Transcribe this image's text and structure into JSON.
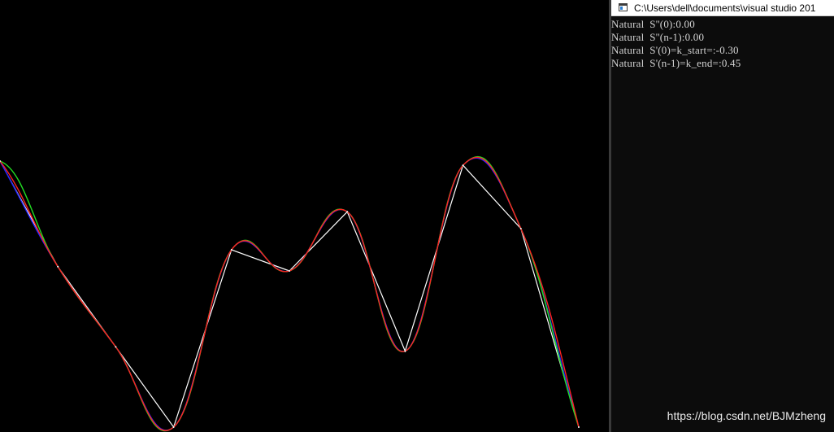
{
  "graphics": {
    "background": "#000000",
    "curves": [
      {
        "name": "polyline",
        "color": "#ffffff"
      },
      {
        "name": "blue-curve",
        "color": "#2323ff"
      },
      {
        "name": "green-curve",
        "color": "#22dd22"
      },
      {
        "name": "red-curve",
        "color": "#ff2020"
      }
    ],
    "points": [
      {
        "x": 0,
        "y": 0.63
      },
      {
        "x": 1,
        "y": 0.38
      },
      {
        "x": 2,
        "y": 0.19
      },
      {
        "x": 3,
        "y": 0.0
      },
      {
        "x": 4,
        "y": 0.42
      },
      {
        "x": 5,
        "y": 0.37
      },
      {
        "x": 6,
        "y": 0.51
      },
      {
        "x": 7,
        "y": 0.18
      },
      {
        "x": 8,
        "y": 0.62
      },
      {
        "x": 9,
        "y": 0.47
      },
      {
        "x": 10,
        "y": 0.0
      }
    ]
  },
  "console": {
    "title": "C:\\Users\\dell\\documents\\visual studio 201",
    "lines": [
      "Natural  S''(0):0.00",
      "Natural  S''(n-1):0.00",
      "Natural  S'(0)=k_start=:-0.30",
      "Natural  S'(n-1)=k_end=:0.45"
    ],
    "colors": {
      "background": "#0c0c0c",
      "text": "#d4d4d4"
    }
  },
  "watermark": "https://blog.csdn.net/BJMzheng"
}
